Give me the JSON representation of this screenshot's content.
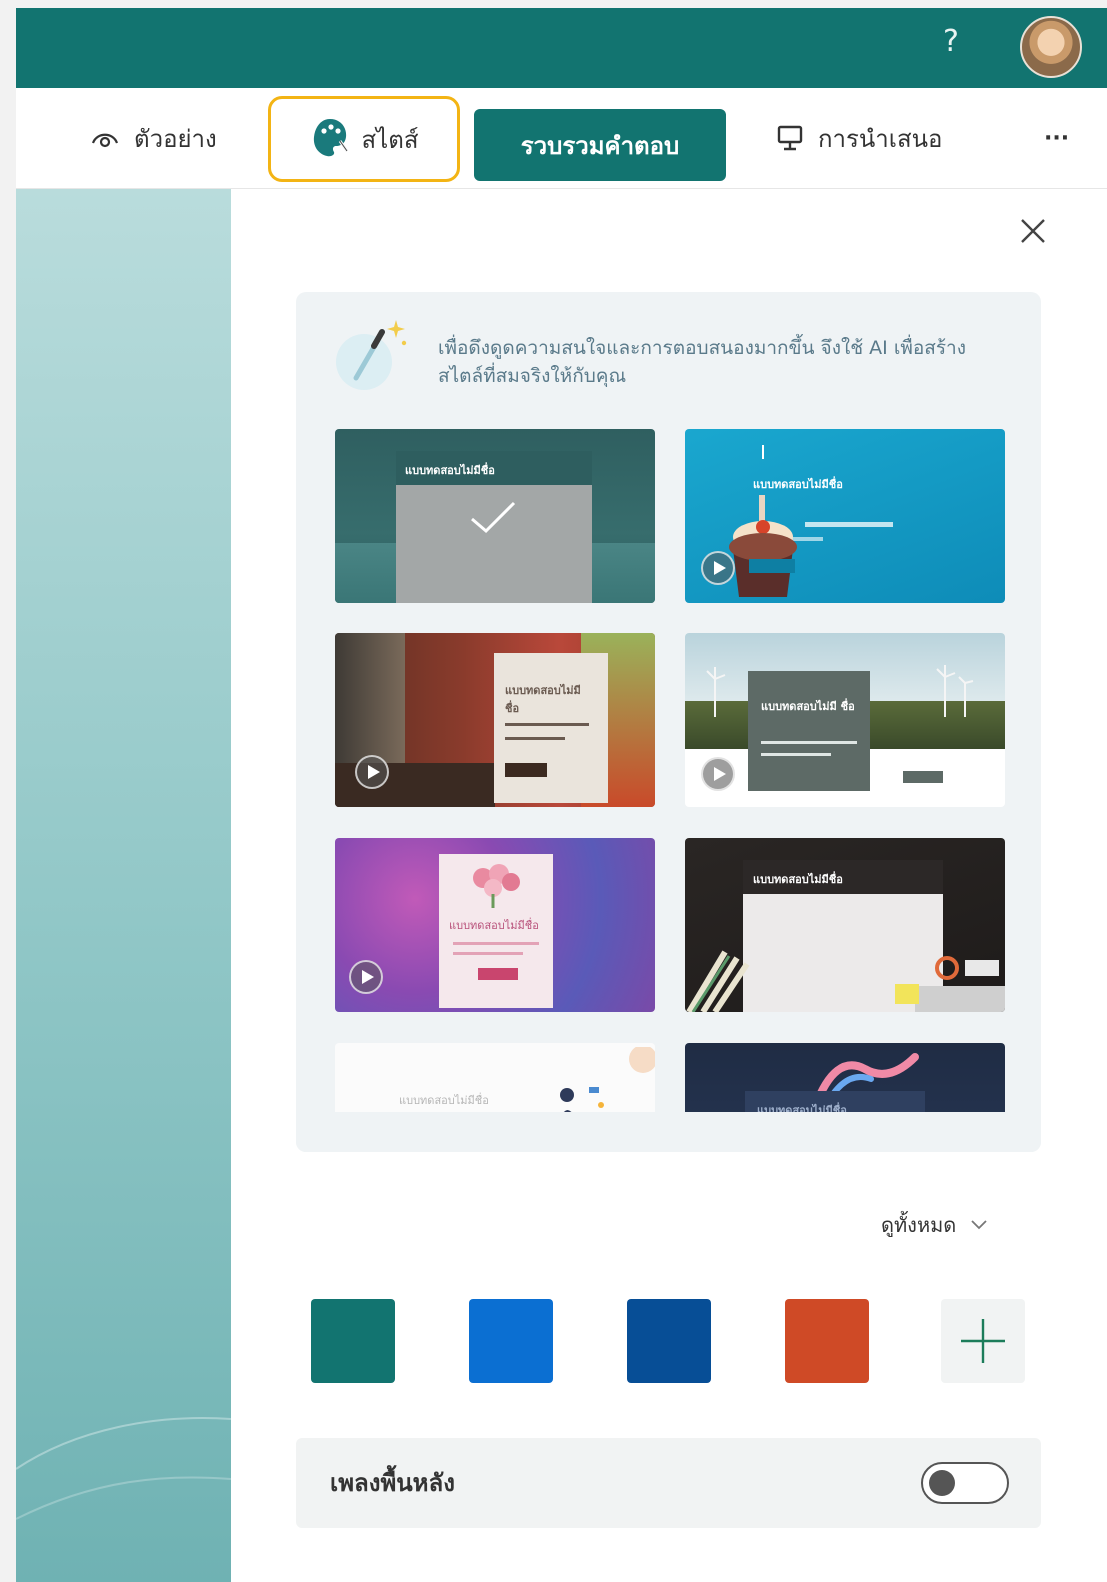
{
  "header": {
    "help_label": "?"
  },
  "toolbar": {
    "preview_label": "ตัวอย่าง",
    "style_label": "สไตส์",
    "collect_label": "รวบรวมคำตอบ",
    "present_label": "การนำเสนอ",
    "more_label": "···"
  },
  "style_panel": {
    "ai_text": "เพื่อดึงดูดความสนใจและการตอบสนองมากขึ้น จึงใช้ AI เพื่อสร้างสไตล์ที่สมจริงให้กับคุณ",
    "thumbnails": [
      {
        "title": "แบบทดสอบไม่มีชื่อ",
        "selected": true
      },
      {
        "title": "แบบทดสอบไม่มีชื่อ",
        "video": true
      },
      {
        "title": "แบบทดสอบไม่มี ชื่อ",
        "video": true
      },
      {
        "title": "แบบทดสอบไม่มี ชื่อ",
        "video": true
      },
      {
        "title": "แบบทดสอบไม่มีชื่อ",
        "video": true
      },
      {
        "title": "แบบทดสอบไม่มีชื่อ"
      },
      {
        "title": "แบบทดสอบไม่มีชื่อ"
      },
      {
        "title": "แบบทดสอบไม่มีชื่อ"
      }
    ],
    "view_all_label": "ดูทั้งหมด",
    "colors": [
      "#127470",
      "#0b6fd2",
      "#074e96",
      "#cf4a26"
    ],
    "music_label": "เพลงพื้นหลัง",
    "music_on": false
  }
}
